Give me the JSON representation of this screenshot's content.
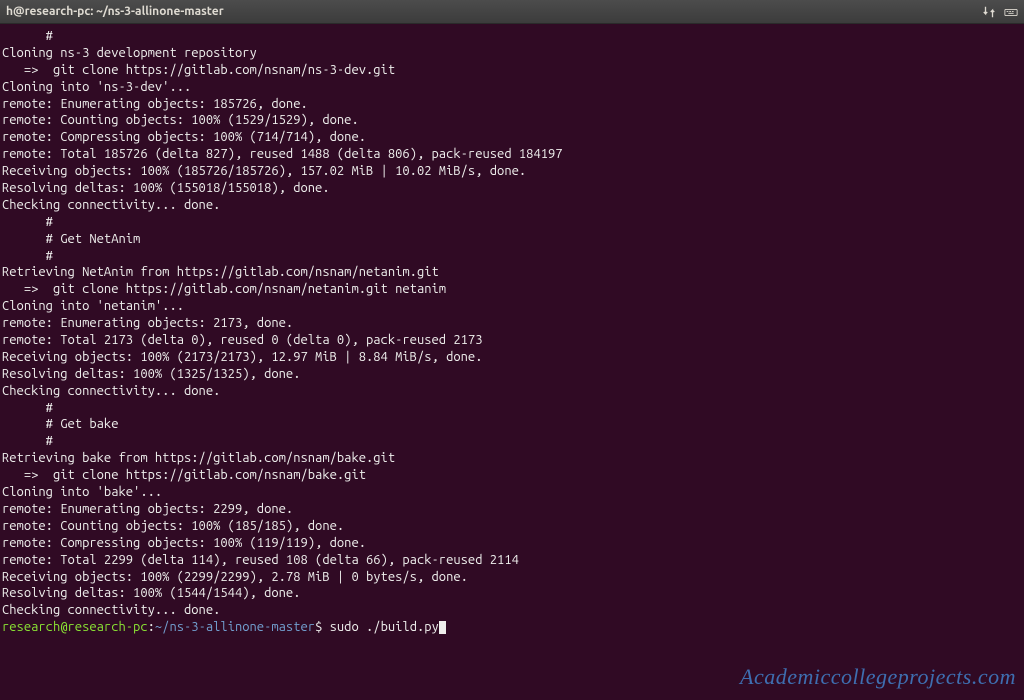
{
  "window": {
    "title": "h@research-pc: ~/ns-3-allinone-master"
  },
  "lines": {
    "l0": "      #",
    "l1": "",
    "l2": "Cloning ns-3 development repository",
    "l3": "   =>  git clone https://gitlab.com/nsnam/ns-3-dev.git",
    "l4": "Cloning into 'ns-3-dev'...",
    "l5": "remote: Enumerating objects: 185726, done.",
    "l6": "remote: Counting objects: 100% (1529/1529), done.",
    "l7": "remote: Compressing objects: 100% (714/714), done.",
    "l8": "remote: Total 185726 (delta 827), reused 1488 (delta 806), pack-reused 184197",
    "l9": "Receiving objects: 100% (185726/185726), 157.02 MiB | 10.02 MiB/s, done.",
    "l10": "Resolving deltas: 100% (155018/155018), done.",
    "l11": "Checking connectivity... done.",
    "l12": "",
    "l13": "      #",
    "l14": "      # Get NetAnim",
    "l15": "      #",
    "l16": "",
    "l17": "Retrieving NetAnim from https://gitlab.com/nsnam/netanim.git",
    "l18": "   =>  git clone https://gitlab.com/nsnam/netanim.git netanim",
    "l19": "Cloning into 'netanim'...",
    "l20": "remote: Enumerating objects: 2173, done.",
    "l21": "remote: Total 2173 (delta 0), reused 0 (delta 0), pack-reused 2173",
    "l22": "Receiving objects: 100% (2173/2173), 12.97 MiB | 8.84 MiB/s, done.",
    "l23": "Resolving deltas: 100% (1325/1325), done.",
    "l24": "Checking connectivity... done.",
    "l25": "",
    "l26": "      #",
    "l27": "      # Get bake",
    "l28": "      #",
    "l29": "",
    "l30": "Retrieving bake from https://gitlab.com/nsnam/bake.git",
    "l31": "   =>  git clone https://gitlab.com/nsnam/bake.git",
    "l32": "Cloning into 'bake'...",
    "l33": "remote: Enumerating objects: 2299, done.",
    "l34": "remote: Counting objects: 100% (185/185), done.",
    "l35": "remote: Compressing objects: 100% (119/119), done.",
    "l36": "remote: Total 2299 (delta 114), reused 108 (delta 66), pack-reused 2114",
    "l37": "Receiving objects: 100% (2299/2299), 2.78 MiB | 0 bytes/s, done.",
    "l38": "Resolving deltas: 100% (1544/1544), done.",
    "l39": "Checking connectivity... done."
  },
  "prompt": {
    "user": "research@research-pc",
    "colon": ":",
    "path": "~/ns-3-allinone-master",
    "dollar": "$ ",
    "command": "sudo ./build.py"
  },
  "watermark": "Academiccollegeprojects.com"
}
